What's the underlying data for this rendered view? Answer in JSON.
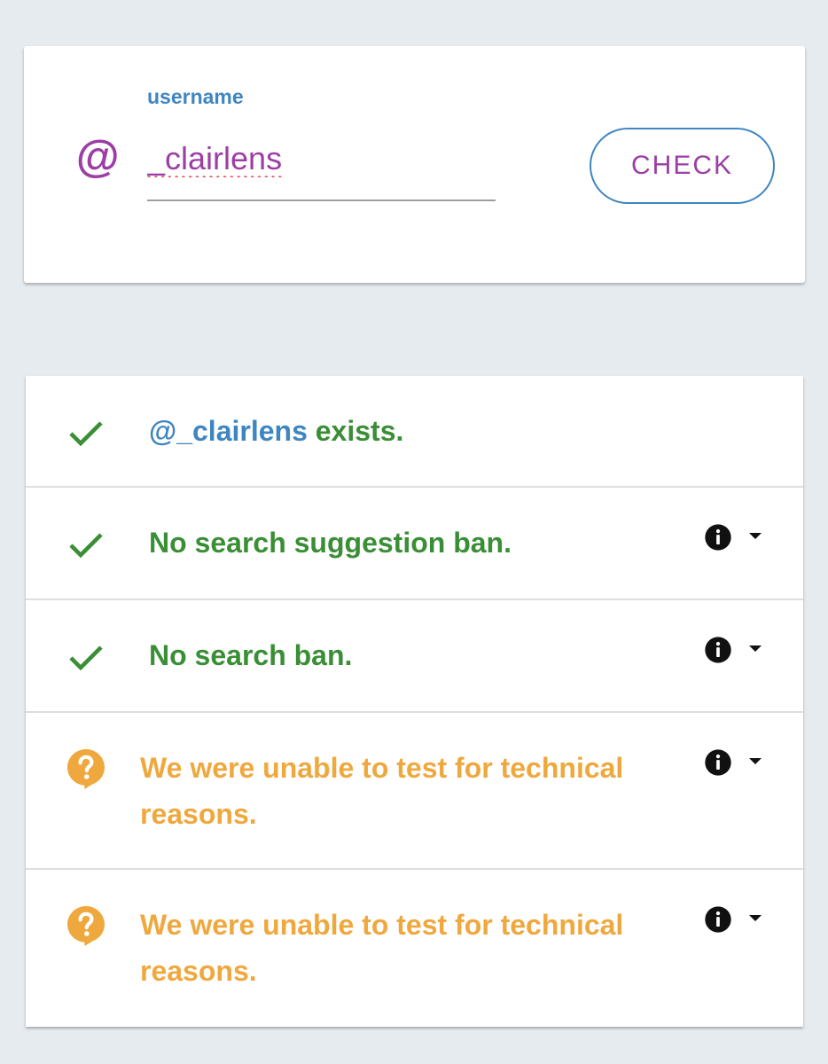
{
  "search": {
    "label": "username",
    "at_symbol": "@",
    "value": "_clairlens",
    "button_label": "CHECK"
  },
  "results": [
    {
      "status": "success",
      "icon": "check-icon",
      "prefix": "@_clairlens",
      "text": " exists.",
      "has_info": false
    },
    {
      "status": "success",
      "icon": "check-icon",
      "text": "No search suggestion ban.",
      "has_info": true
    },
    {
      "status": "success",
      "icon": "check-icon",
      "text": "No search ban.",
      "has_info": true
    },
    {
      "status": "unknown",
      "icon": "question-bubble-icon",
      "text": "We were unable to test for technical reasons.",
      "has_info": true
    },
    {
      "status": "unknown",
      "icon": "question-bubble-icon",
      "text": "We were unable to test for technical reasons.",
      "has_info": true
    }
  ],
  "colors": {
    "background": "#e6ebef",
    "accent_blue": "#3f86c1",
    "accent_purple": "#9c3ea5",
    "success_green": "#3a8e35",
    "warning_orange": "#efa83e"
  }
}
